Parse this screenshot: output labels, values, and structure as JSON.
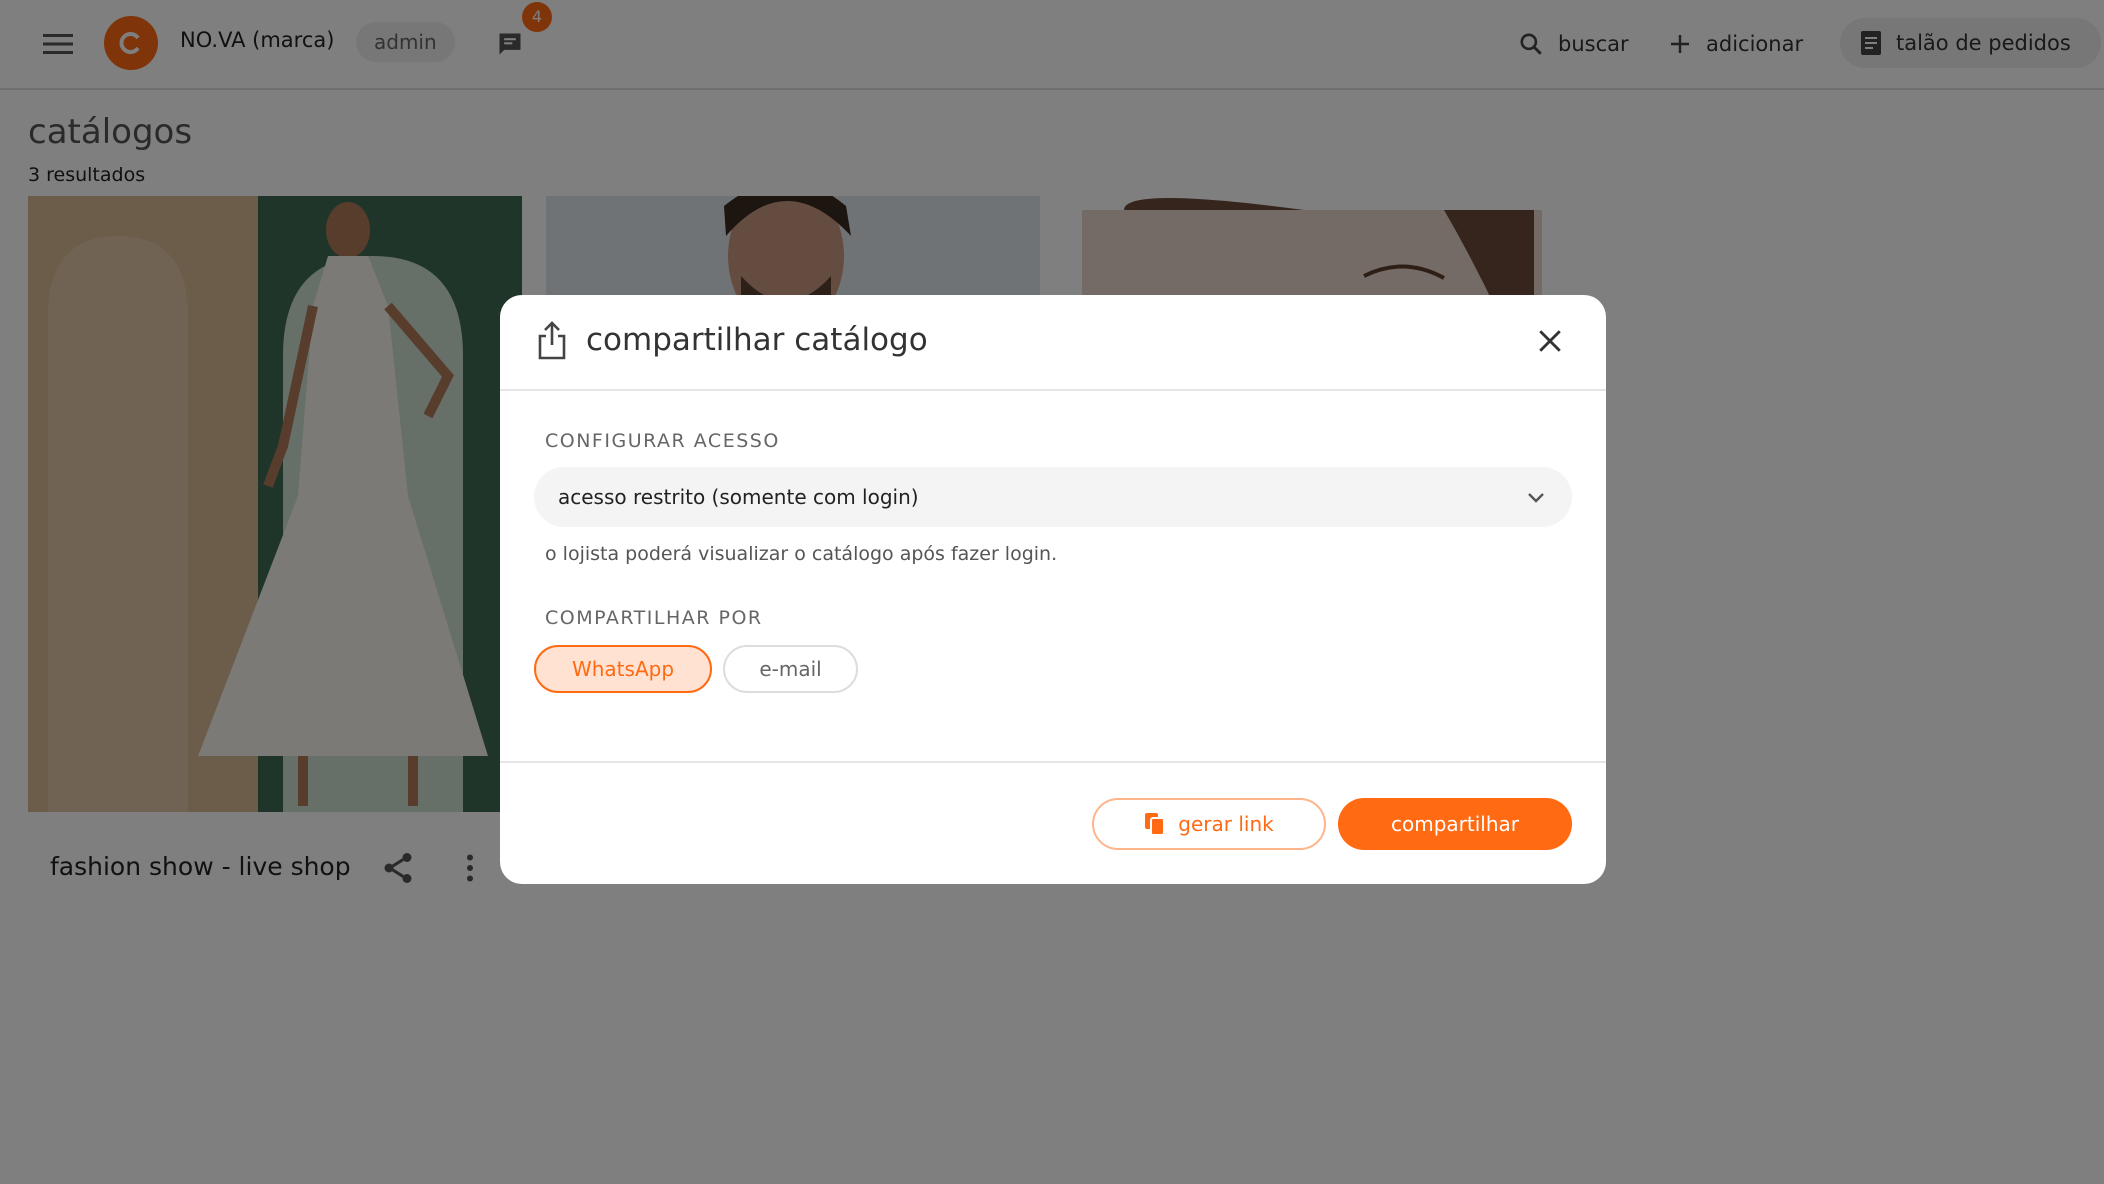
{
  "topbar": {
    "brand": "NO.VA (marca)",
    "role": "admin",
    "chat_badge": "4",
    "search_label": "buscar",
    "add_label": "adicionar",
    "orders_label": "talão de pedidos",
    "accent_color": "#ff6a13"
  },
  "page": {
    "title": "catálogos",
    "results": "3 resultados"
  },
  "catalogs": [
    {
      "name": "fashion show - live shop",
      "image": "woman-white-dress-photo"
    },
    {
      "name": "",
      "image": "man-portrait-photo"
    },
    {
      "name": "",
      "image": "woman-closeup-photo"
    }
  ],
  "modal": {
    "title": "compartilhar catálogo",
    "access_label": "CONFIGURAR ACESSO",
    "access_value": "acesso restrito (somente com login)",
    "access_helper": "o lojista poderá visualizar o catálogo após fazer login.",
    "share_by_label": "COMPARTILHAR POR",
    "channels": [
      {
        "label": "WhatsApp",
        "selected": true
      },
      {
        "label": "e-mail",
        "selected": false
      }
    ],
    "generate_link_label": "gerar link",
    "share_button_label": "compartilhar"
  }
}
